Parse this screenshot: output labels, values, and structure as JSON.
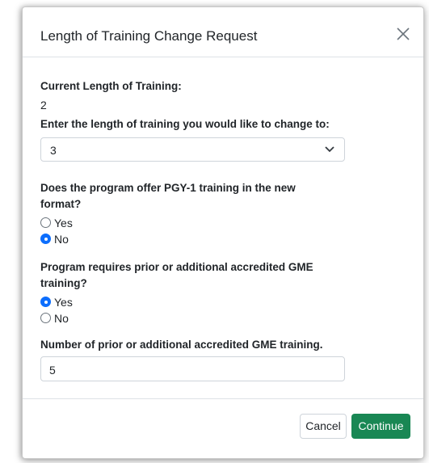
{
  "modal": {
    "title": "Length of Training Change Request"
  },
  "current_length": {
    "label": "Current Length of Training:",
    "value": "2"
  },
  "new_length": {
    "label": "Enter the length of training you would like to change to:",
    "selected": "3"
  },
  "pgy1": {
    "question_line1": "Does the program offer PGY-1 training in the new",
    "question_line2": "format?",
    "options": [
      "Yes",
      "No"
    ],
    "selected": "No"
  },
  "prior_training": {
    "question_line1": "Program requires prior or additional accredited GME",
    "question_line2": "training?",
    "options": [
      "Yes",
      "No"
    ],
    "selected": "Yes"
  },
  "prior_count": {
    "label": "Number of prior or additional accredited GME training.",
    "value": "5"
  },
  "footer": {
    "cancel_label": "Cancel",
    "continue_label": "Continue"
  },
  "colors": {
    "primary": "#0d6efd",
    "success": "#198754",
    "marker": "#f5d90a"
  },
  "icons": {
    "close": "close-icon",
    "select_arrow": "chevron-down-icon"
  }
}
